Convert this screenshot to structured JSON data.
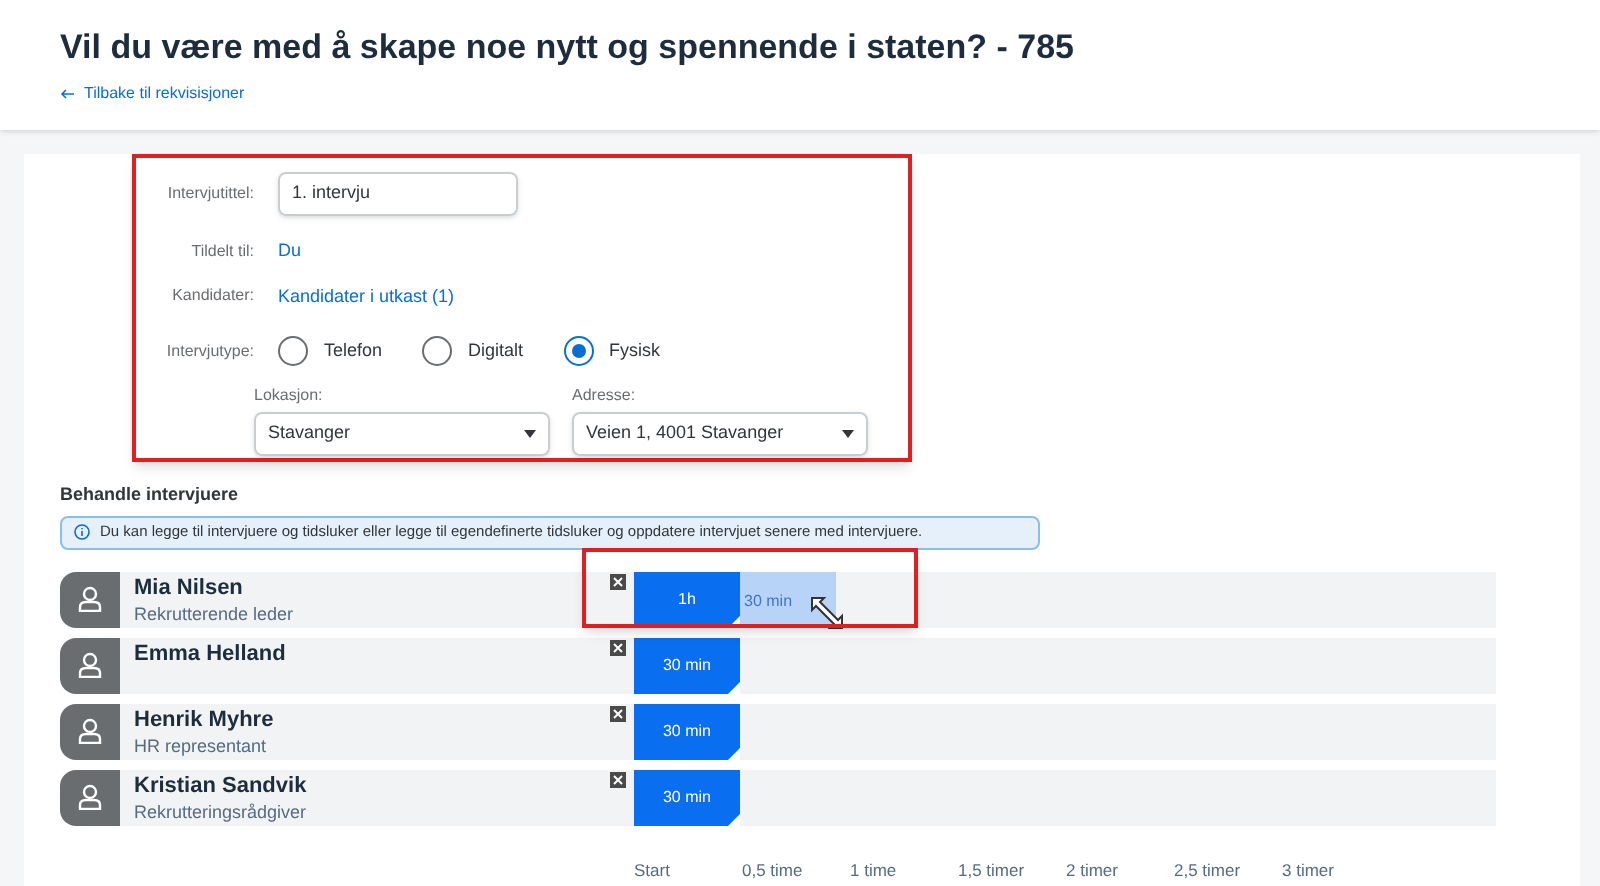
{
  "title": "Vil du være med å skape noe nytt og spennende i staten? - 785",
  "back_link": "Tilbake til rekvisisjoner",
  "form": {
    "highlighted": true,
    "title_label": "Intervjutittel:",
    "title_value": "1. intervju",
    "assigned_label": "Tildelt til:",
    "assigned_value": "Du",
    "candidates_label": "Kandidater:",
    "candidates_value": "Kandidater i utkast (1)",
    "type_label": "Intervjutype:",
    "types": [
      {
        "label": "Telefon",
        "selected": false
      },
      {
        "label": "Digitalt",
        "selected": false
      },
      {
        "label": "Fysisk",
        "selected": true
      }
    ],
    "selects": [
      {
        "label": "Lokasjon:",
        "value": "Stavanger"
      },
      {
        "label": "Adresse:",
        "value": "Veien 1, 4001 Stavanger"
      }
    ]
  },
  "section_title": "Behandle intervjuere",
  "info": "Du kan legge til intervjuere og tidsluker eller legge til egendefinerte tidsluker og oppdatere intervjuet senere med intervjuere.",
  "interviewers": [
    {
      "name": "Mia Nilsen",
      "role": "Rekrutterende leder",
      "slot": "1h",
      "ghost": "30 min",
      "resizing": true
    },
    {
      "name": "Emma Helland",
      "slot": "30 min",
      "resizing": false
    },
    {
      "name": "Henrik Myhre",
      "role": "HR representant",
      "slot": "30 min",
      "resizing": false
    },
    {
      "name": "Kristian Sandvik",
      "role": "Rekrutteringsrådgiver",
      "slot": "30 min",
      "resizing": false
    }
  ],
  "timeline": [
    "Start",
    "0,5 time",
    "1 time",
    "1,5 timer",
    "2 timer",
    "2,5 timer",
    "3 timer"
  ]
}
